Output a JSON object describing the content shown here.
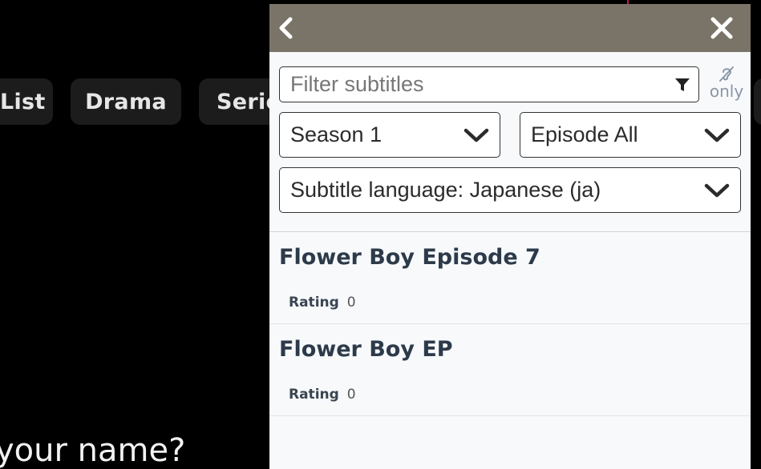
{
  "background": {
    "chips": [
      "List",
      "Drama",
      "Series"
    ],
    "question_fragment": "your name?"
  },
  "panel": {
    "header": {
      "back_icon": "chevron-left-icon",
      "close_icon": "close-icon",
      "color": "#7a7468"
    },
    "search": {
      "placeholder": "Filter subtitles",
      "value": ""
    },
    "hearing_impaired_toggle": {
      "label": "only",
      "icon": "ear-icon"
    },
    "season_select": {
      "selected": "Season 1"
    },
    "episode_select": {
      "selected": "Episode All"
    },
    "language_select": {
      "selected": "Subtitle language: Japanese (ja)"
    },
    "results": [
      {
        "title": "Flower Boy Episode 7",
        "rating_label": "Rating",
        "rating": "0"
      },
      {
        "title": "Flower Boy EP",
        "rating_label": "Rating",
        "rating": "0"
      }
    ]
  }
}
